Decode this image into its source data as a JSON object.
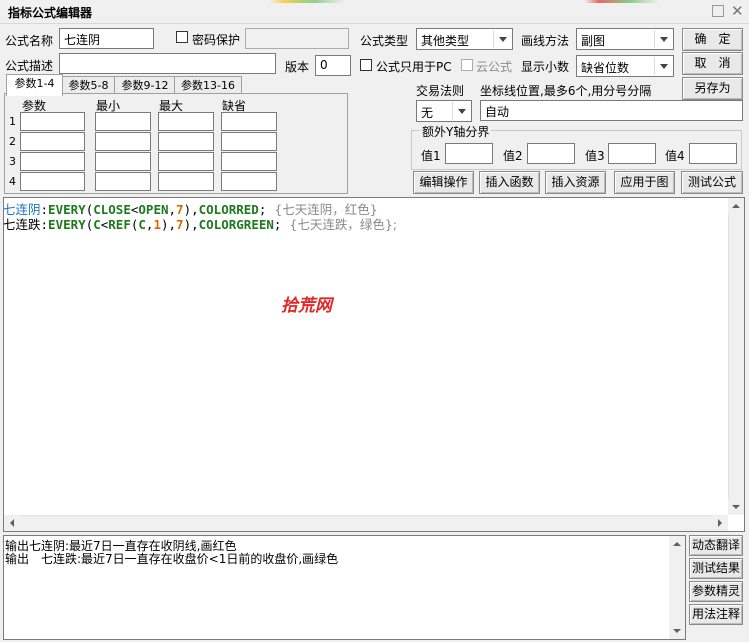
{
  "window": {
    "title": "指标公式编辑器"
  },
  "form": {
    "name_label": "公式名称",
    "name_value": "七连阴",
    "password_label": "密码保护",
    "desc_label": "公式描述",
    "desc_value": "",
    "version_label": "版本",
    "version_value": "0",
    "formula_type_label": "公式类型",
    "formula_type_value": "其他类型",
    "draw_method_label": "画线方法",
    "draw_method_value": "副图",
    "pc_only_label": "公式只用于PC",
    "cloud_label": "云公式",
    "decimals_label": "显示小数",
    "decimals_value": "缺省位数"
  },
  "buttons": {
    "ok": "确　定",
    "cancel": "取　消",
    "save_as": "另存为",
    "edit_op": "编辑操作",
    "insert_func": "插入函数",
    "insert_res": "插入资源",
    "apply_chart": "应用于图",
    "test_formula": "测试公式"
  },
  "tabs": [
    "参数1-4",
    "参数5-8",
    "参数9-12",
    "参数13-16"
  ],
  "params": {
    "headers": [
      "参数",
      "最小",
      "最大",
      "缺省"
    ],
    "rows": [
      "1",
      "2",
      "3",
      "4"
    ]
  },
  "trade": {
    "rule_label": "交易法则",
    "rule_value": "无",
    "coord_label": "坐标线位置,最多6个,用分号分隔",
    "coord_value": "自动"
  },
  "yaxis": {
    "group_label": "额外Y轴分界",
    "v1": "值1",
    "v2": "值2",
    "v3": "值3",
    "v4": "值4"
  },
  "code": {
    "line1": {
      "name": "七连阴",
      "colon": ":",
      "fn": "EVERY",
      "p1": "(",
      "a": "CLOSE",
      "op": "<",
      "b": "OPEN",
      "comma": ",",
      "n": "7",
      "p2": ")",
      "comma2": ",",
      "color": "COLORRED",
      "end": ";",
      "comment": "  {七天连阴，红色}"
    },
    "line2": {
      "name": "七连跌",
      "colon": ":",
      "fn": "EVERY",
      "p1": "(",
      "a": "C",
      "op": "<",
      "ref": "REF",
      "p3": "(",
      "c": "C",
      "comma": ",",
      "one": "1",
      "p4": ")",
      "p5": ")",
      "comma2": ",",
      "n": "7",
      "p2": ")",
      "comma3": ",",
      "color": "COLORGREEN",
      "end": ";",
      "comment": "  {七天连跌，绿色};"
    }
  },
  "watermark": "拾荒网",
  "output": {
    "line1": "输出七连阴:最近7日一直存在收阴线,画红色",
    "line2": "输出　七连跌:最近7日一直存在收盘价<1日前的收盘价,画绿色"
  },
  "side_buttons": [
    "动态翻译",
    "测试结果",
    "参数精灵",
    "用法注释"
  ],
  "colors": {
    "name": "#1a74c6",
    "keyword": "#1d7a1d",
    "number": "#d86a00",
    "comment": "#8a8a8a",
    "watermark": "#e32626"
  }
}
